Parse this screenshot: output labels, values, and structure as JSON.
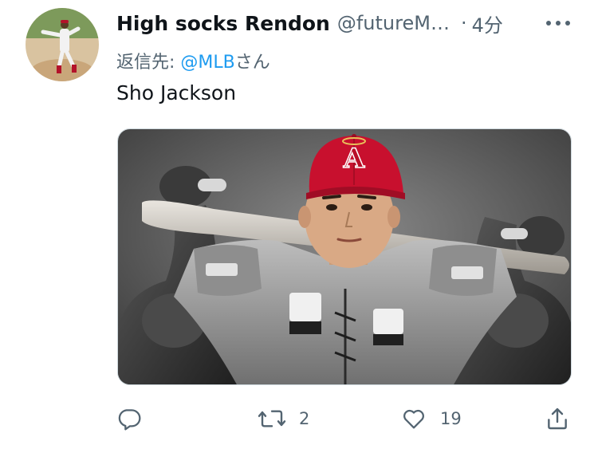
{
  "tweet": {
    "author": {
      "display_name": "High socks Rendon",
      "handle": "@futureM…",
      "avatar_icon": "baseball-player-avatar"
    },
    "separator": "·",
    "timestamp": "4分",
    "more_icon": "more-icon",
    "reply_to": {
      "prefix": "返信先: ",
      "mention": "@MLB",
      "suffix": "さん"
    },
    "text": "Sho Jackson",
    "media": {
      "type": "photo",
      "cap_logo": "A"
    },
    "actions": {
      "reply_icon": "reply-icon",
      "retweet_icon": "retweet-icon",
      "retweet_count": "2",
      "like_icon": "heart-icon",
      "like_count": "19",
      "share_icon": "share-icon"
    }
  },
  "colors": {
    "text_primary": "#0f1419",
    "text_secondary": "#536471",
    "link": "#1d9bf0",
    "cap_red": "#c8102e"
  }
}
